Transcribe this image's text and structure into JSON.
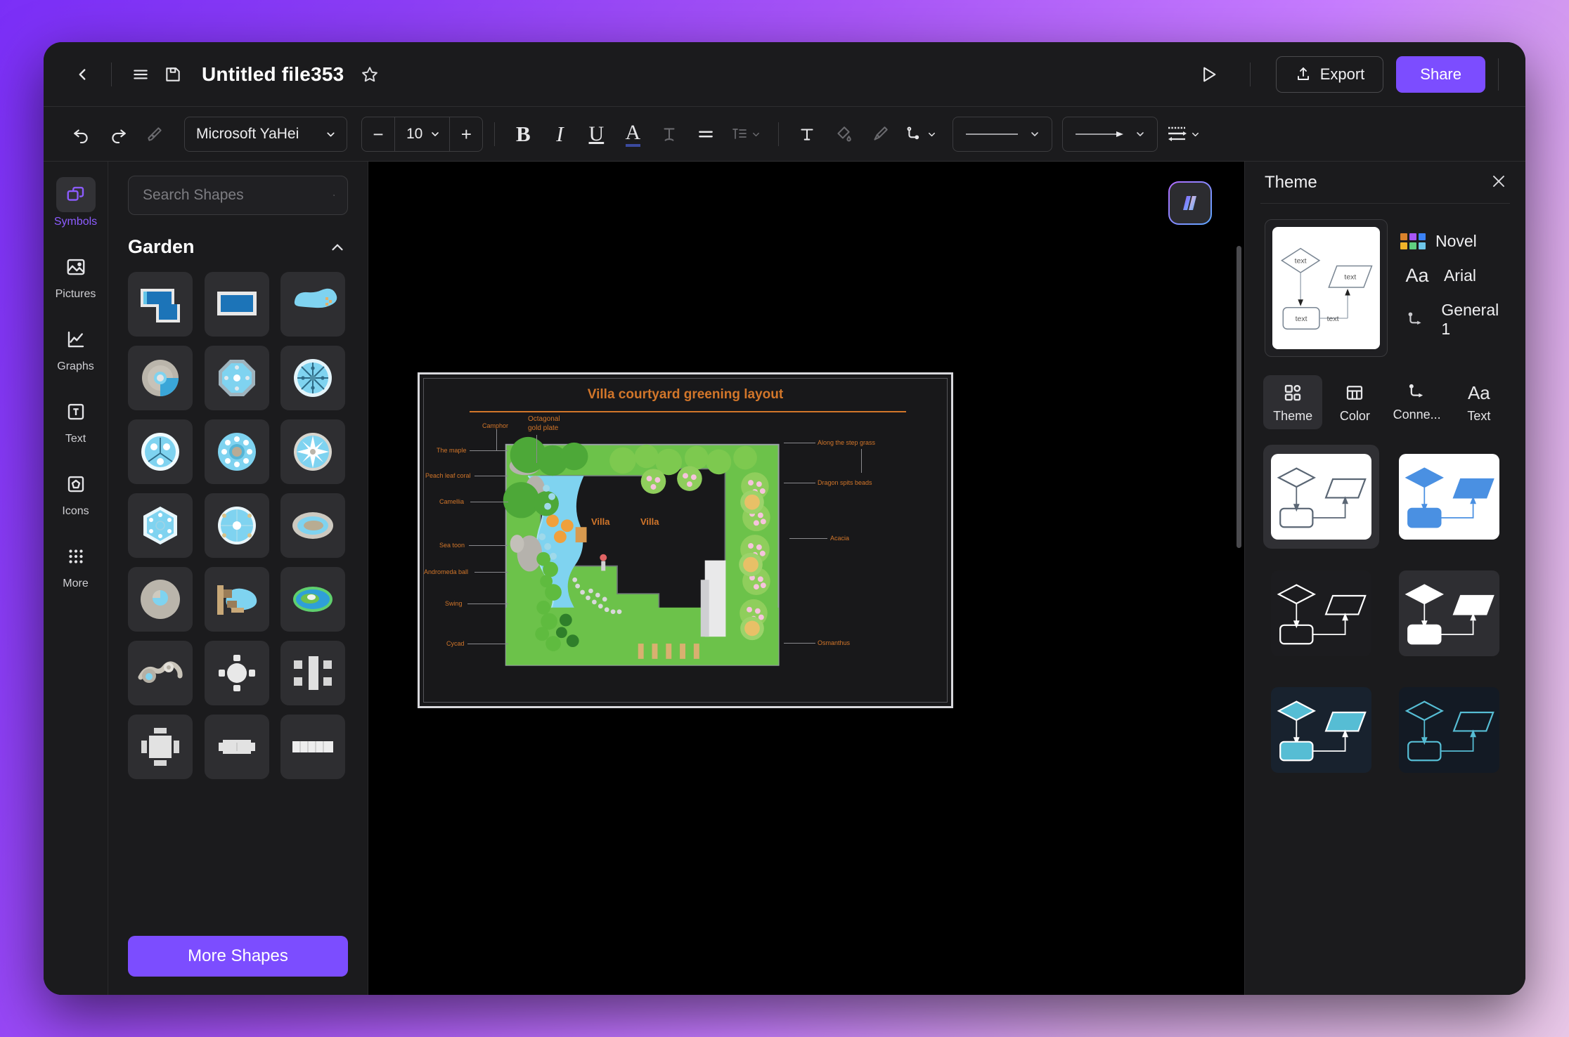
{
  "header": {
    "back_icon": "chevron-left-icon",
    "menu_icon": "hamburger-menu-icon",
    "save_icon": "save-disk-icon",
    "title": "Untitled file353",
    "favorite_icon": "star-icon",
    "present_icon": "play-triangle-icon",
    "export_label": "Export",
    "export_icon": "upload-icon",
    "share_label": "Share"
  },
  "toolbar": {
    "undo_icon": "undo-arrow-icon",
    "redo_icon": "redo-arrow-icon",
    "format_painter_icon": "format-painter-icon",
    "font_family": "Microsoft YaHei",
    "font_size": "10",
    "decrease_label": "−",
    "increase_label": "+",
    "bold_label": "B",
    "italic_label": "I",
    "underline_label": "U",
    "font_color_label": "A",
    "strikethrough_icon": "text-shadow-icon",
    "align_icon": "align-left-icon",
    "line_spacing_icon": "line-spacing-icon",
    "textbox_icon": "text-box-icon",
    "fill_icon": "fill-bucket-icon",
    "brush_icon": "brush-icon",
    "connector_icon": "connector-elbow-icon",
    "line_style_icon": "solid-line-icon",
    "arrow_style_icon": "arrow-line-icon",
    "line_options_icon": "line-options-icon"
  },
  "sidebar": {
    "items": [
      {
        "label": "Symbols",
        "icon": "shapes-icon",
        "active": true
      },
      {
        "label": "Pictures",
        "icon": "picture-icon",
        "active": false
      },
      {
        "label": "Graphs",
        "icon": "chart-line-icon",
        "active": false
      },
      {
        "label": "Text",
        "icon": "text-t-icon",
        "active": false
      },
      {
        "label": "Icons",
        "icon": "pentagon-icon",
        "active": false
      },
      {
        "label": "More",
        "icon": "grid-dots-icon",
        "active": false
      }
    ]
  },
  "shapes_panel": {
    "search_placeholder": "Search Shapes",
    "search_value": "",
    "search_icon": "search-icon",
    "category": "Garden",
    "collapse_icon": "chevron-up-icon",
    "more_shapes_label": "More Shapes",
    "shapes": [
      {
        "name": "l-shaped-pool",
        "kind": "pool-l"
      },
      {
        "name": "rectangular-pool",
        "kind": "pool-rect"
      },
      {
        "name": "freeform-pond",
        "kind": "pond-blob"
      },
      {
        "name": "stone-round-pool",
        "kind": "stone-round"
      },
      {
        "name": "octagonal-plaza",
        "kind": "octagon"
      },
      {
        "name": "compass-rose-pool",
        "kind": "compass"
      },
      {
        "name": "tri-segment-fountain",
        "kind": "tri-pool"
      },
      {
        "name": "dotted-ring-fountain",
        "kind": "dot-ring"
      },
      {
        "name": "star-burst-pool",
        "kind": "star-pool"
      },
      {
        "name": "hexagonal-pool",
        "kind": "hexagon"
      },
      {
        "name": "circular-plaza",
        "kind": "circle-plaza"
      },
      {
        "name": "rock-pond",
        "kind": "rock-pond"
      },
      {
        "name": "pebble-ring-pool",
        "kind": "pebble-ring"
      },
      {
        "name": "deck-pond",
        "kind": "deck-pond"
      },
      {
        "name": "island-lake",
        "kind": "island-lake"
      },
      {
        "name": "winding-path-pond",
        "kind": "winding"
      },
      {
        "name": "round-table-seats",
        "kind": "round-table"
      },
      {
        "name": "bench-group",
        "kind": "bench-group"
      },
      {
        "name": "square-table-seats",
        "kind": "square-table"
      },
      {
        "name": "stone-bench",
        "kind": "stone-bench"
      },
      {
        "name": "long-bench",
        "kind": "long-bench"
      }
    ]
  },
  "canvas": {
    "ai_badge_icon": "ai-assistant-icon",
    "diagram": {
      "title": "Villa courtyard greening layout",
      "labels_top": [
        {
          "text": "Camphor"
        },
        {
          "text": "Octagonal\ngold plate"
        }
      ],
      "labels_left": [
        "The maple",
        "Peach leaf coral",
        "Camellia",
        "Sea toon",
        "Andromeda ball",
        "Swing",
        "Cycad"
      ],
      "labels_right": [
        "Along the step grass",
        "Dragon spits beads",
        "Acacia",
        "Osmanthus"
      ],
      "buildings": [
        "Villa",
        "Villa"
      ],
      "accent_color": "#d2762a"
    }
  },
  "theme_panel": {
    "title": "Theme",
    "close_icon": "close-x-icon",
    "properties": [
      {
        "label": "Novel",
        "icon": "color-swatches-icon"
      },
      {
        "label": "Arial",
        "icon": "font-aa-icon"
      },
      {
        "label": "General 1",
        "icon": "connector-icon"
      }
    ],
    "swatch_colors": [
      "#d9822b",
      "#a855f7",
      "#3b82f6",
      "#f0b429",
      "#5fcf80",
      "#6ec6e8"
    ],
    "tabs": [
      {
        "label": "Theme",
        "icon": "theme-grid-icon",
        "active": true
      },
      {
        "label": "Color",
        "icon": "color-table-icon",
        "active": false
      },
      {
        "label": "Conne...",
        "icon": "connector-icon",
        "active": false
      },
      {
        "label": "Text",
        "icon": "font-aa-icon",
        "active": false
      }
    ],
    "cards": [
      {
        "name": "theme-white-outline",
        "bg": "#ffffff",
        "fill": "none",
        "stroke": "#5a6674",
        "selected": true
      },
      {
        "name": "theme-white-blue",
        "bg": "#ffffff",
        "fill": "#4a90e2",
        "stroke": "#4a90e2",
        "selected": false
      },
      {
        "name": "theme-dark-outline",
        "bg": "#1c1c1f",
        "fill": "none",
        "stroke": "#ffffff",
        "selected": false
      },
      {
        "name": "theme-dark-white",
        "bg": "#2e2e32",
        "fill": "#ffffff",
        "stroke": "#ffffff",
        "selected": false
      },
      {
        "name": "theme-navy-cyan-fill",
        "bg": "#18222e",
        "fill": "#56bdd4",
        "stroke": "#ffffff",
        "selected": false
      },
      {
        "name": "theme-navy-cyan-line",
        "bg": "#131a24",
        "fill": "none",
        "stroke": "#56bdd4",
        "selected": false
      }
    ]
  }
}
